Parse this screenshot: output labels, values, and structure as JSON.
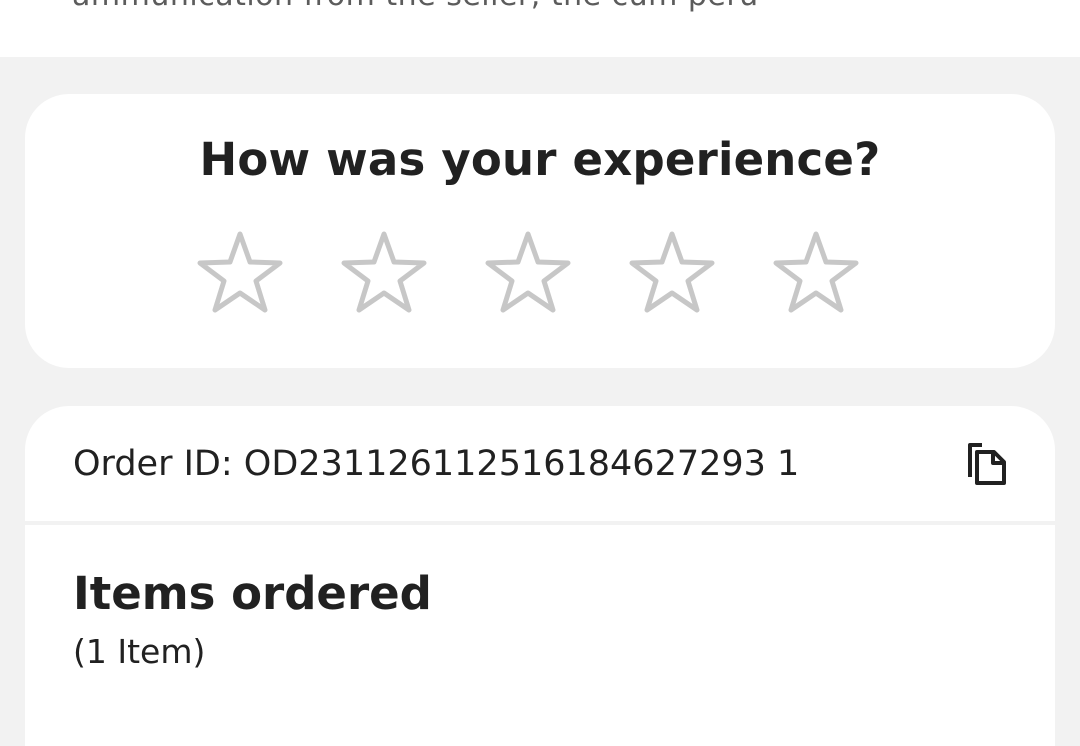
{
  "top_sheet": {
    "cut_text": "ammunication from the seller, the cum peru"
  },
  "rating": {
    "title": "How was your experience?",
    "stars": [
      {
        "label": "1 star",
        "filled": false
      },
      {
        "label": "2 stars",
        "filled": false
      },
      {
        "label": "3 stars",
        "filled": false
      },
      {
        "label": "4 stars",
        "filled": false
      },
      {
        "label": "5 stars",
        "filled": false
      }
    ],
    "star_outline_color": "#c7c7c7",
    "value_out_of_5": 0
  },
  "order": {
    "order_id_text": "Order ID: OD231126112516184627293 1",
    "copy_icon": "copy-icon"
  },
  "items": {
    "title": "Items ordered",
    "count_text": "(1 Item)"
  },
  "colors": {
    "page_background": "#f2f2f2",
    "card_background": "#ffffff",
    "text_primary": "#212121"
  }
}
